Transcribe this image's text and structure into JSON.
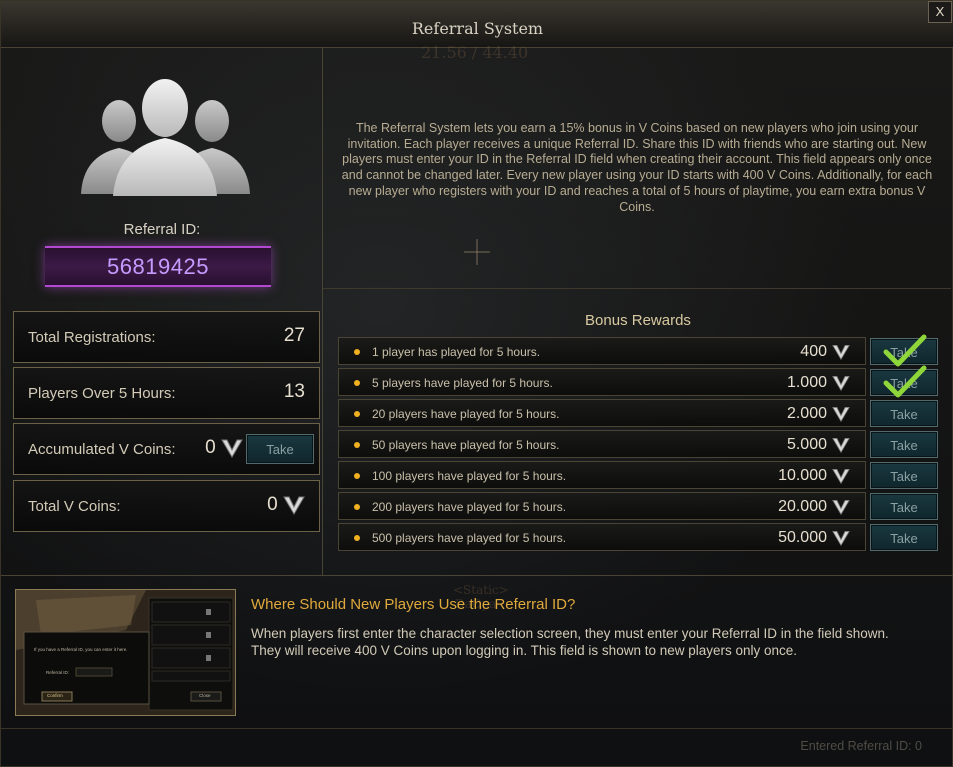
{
  "window": {
    "title": "Referral System",
    "close_label": "X"
  },
  "referral": {
    "id_label": "Referral ID:",
    "id_value": "56819425"
  },
  "stats": {
    "total_registrations": {
      "label": "Total Registrations:",
      "value": "27"
    },
    "players_over_5h": {
      "label": "Players Over 5 Hours:",
      "value": "13"
    },
    "accumulated": {
      "label": "Accumulated V Coins:",
      "value": "0",
      "take_label": "Take"
    },
    "total_vcoins": {
      "label": "Total V Coins:",
      "value": "0"
    }
  },
  "description": "The Referral System lets you earn a 15% bonus in V Coins based on new players who join using your invitation. Each player receives a unique Referral ID. Share this ID with friends who are starting out. New players must enter your ID in the Referral ID field when creating their account. This field appears only once and cannot be changed later. Every new player using your ID starts with 400 V Coins. Additionally, for each new player who registers with your ID and reaches a total of 5 hours of playtime, you earn extra bonus V Coins.",
  "bonus": {
    "title": "Bonus Rewards",
    "rewards": [
      {
        "label": "1 player has played for 5 hours.",
        "amount": "400",
        "take_label": "Take",
        "claimed": true
      },
      {
        "label": "5 players have played for 5 hours.",
        "amount": "1.000",
        "take_label": "Take",
        "claimed": true
      },
      {
        "label": "20 players have played for 5 hours.",
        "amount": "2.000",
        "take_label": "Take",
        "claimed": false
      },
      {
        "label": "50 players have played for 5 hours.",
        "amount": "5.000",
        "take_label": "Take",
        "claimed": false
      },
      {
        "label": "100 players have played for 5 hours.",
        "amount": "10.000",
        "take_label": "Take",
        "claimed": false
      },
      {
        "label": "200 players have played for 5 hours.",
        "amount": "20.000",
        "take_label": "Take",
        "claimed": false
      },
      {
        "label": "500 players have played for 5 hours.",
        "amount": "50.000",
        "take_label": "Take",
        "claimed": false
      }
    ]
  },
  "help": {
    "title": "Where Should New Players Use the Referral ID?",
    "text": "When players first enter the character selection screen, they must enter your Referral ID in the field shown. They will receive 400 V Coins upon logging in. This field is shown to new players only once.",
    "screenshot": {
      "dialog_text": "If you have a Referral ID, you can enter it here.",
      "field_label": "Referral ID:",
      "confirm_label": "Confirm",
      "close_label": "Close"
    }
  },
  "footer": {
    "entered_id": "Entered Referral ID: 0"
  },
  "background": {
    "ghost_top": "21.56 / 44.40",
    "ghost_mid_1": "<Static>",
    "ghost_mid_2": "DaOpa"
  },
  "colors": {
    "accent_gold": "#e0a93c",
    "referral_purple": "#c59bff",
    "check_green": "#8fd63a",
    "reward_dot": "#f0b020"
  },
  "icons": [
    "v-coin-icon",
    "checkmark-icon",
    "users-silhouette-icon",
    "padlock-icon"
  ]
}
